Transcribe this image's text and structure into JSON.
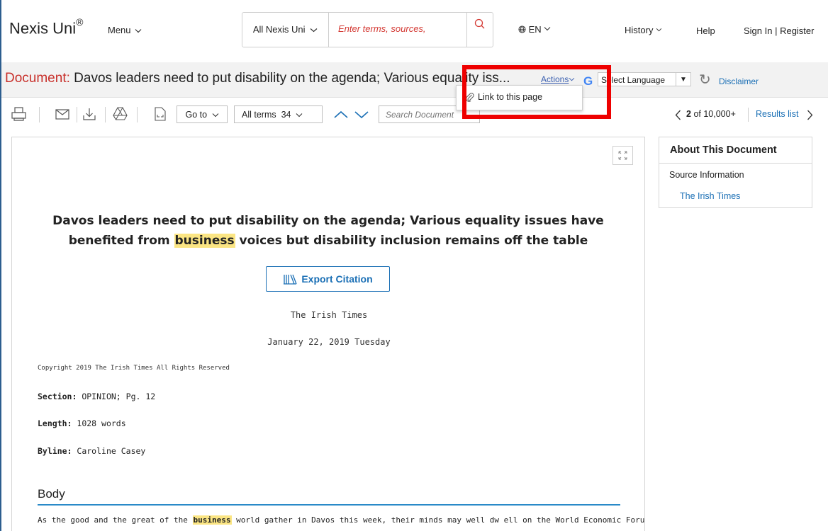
{
  "header": {
    "logo_text": "Nexis Uni",
    "logo_mark": "®",
    "menu_label": "Menu",
    "search_scope": "All Nexis Uni",
    "search_placeholder": "Enter terms, sources,",
    "language_label": "EN",
    "history_label": "History",
    "help_label": "Help",
    "signin_label": "Sign In | Register"
  },
  "title_bar": {
    "label": "Document:",
    "title": "Davos leaders need to put disability on the agenda; Various equality iss...",
    "actions_label": "Actions",
    "google_letter": "G",
    "select_language": "Select Language",
    "disclaimer": "Disclaimer"
  },
  "actions_menu": {
    "items": [
      {
        "label": "Link to this page",
        "icon": "paperclip-icon"
      }
    ]
  },
  "toolbar": {
    "icons": [
      "print-icon",
      "email-icon",
      "download-icon",
      "google-drive-icon",
      "fullscreen-doc-icon"
    ],
    "goto_label": "Go to",
    "allterms_label": "All terms",
    "allterms_count": "34",
    "search_placeholder": "Search Document",
    "pager_current": "2",
    "pager_total": "of 10,000+",
    "results_list": "Results list"
  },
  "document": {
    "headline_part1": "Davos leaders need to put disability on the agenda; Various equality issues have benefited from ",
    "headline_highlight": "business",
    "headline_part2": " voices but disability inclusion remains off the table",
    "export_label": "Export Citation",
    "source": "The Irish Times",
    "date": "January 22, 2019 Tuesday",
    "copyright": "Copyright 2019 The Irish Times All Rights Reserved",
    "section_label": "Section:",
    "section_value": "OPINION; Pg. 12",
    "length_label": "Length:",
    "length_value": "1028 words",
    "byline_label": "Byline:",
    "byline_value": "Caroline Casey",
    "body_heading": "Body",
    "body_part1": "As the good and the great of the ",
    "body_highlight": "business",
    "body_part2": " world gather in Davos this week, their minds may well dw ell on the World Economic Forum's"
  },
  "about_panel": {
    "heading": "About This Document",
    "source_info": "Source Information",
    "source_link": "The Irish Times"
  },
  "colors": {
    "accent_red": "#c8302b",
    "link_blue": "#1a6fb5",
    "highlight_yellow": "#fbe583",
    "annotation_red": "#ee0000"
  }
}
